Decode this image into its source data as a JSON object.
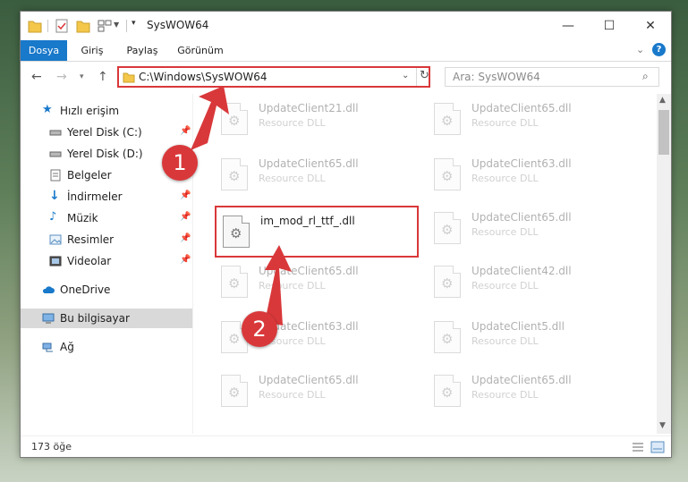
{
  "window": {
    "title": "SysWOW64",
    "controls": {
      "minimize": "—",
      "maximize": "☐",
      "close": "✕"
    }
  },
  "ribbon": {
    "tabs": [
      "Dosya",
      "Giriş",
      "Paylaş",
      "Görünüm"
    ],
    "active_tab": "Dosya"
  },
  "address": {
    "path": "C:\\Windows\\SysWOW64",
    "search_placeholder": "Ara: SysWOW64"
  },
  "nav": {
    "items": [
      {
        "label": "Hızlı erişim",
        "icon": "star-icon",
        "pinned": false
      },
      {
        "label": "Yerel Disk (C:)",
        "icon": "drive-icon",
        "pinned": true
      },
      {
        "label": "Yerel Disk (D:)",
        "icon": "drive-icon",
        "pinned": false
      },
      {
        "label": "Belgeler",
        "icon": "documents-icon",
        "pinned": false
      },
      {
        "label": "İndirmeler",
        "icon": "download-icon",
        "pinned": true
      },
      {
        "label": "Müzik",
        "icon": "music-icon",
        "pinned": true
      },
      {
        "label": "Resimler",
        "icon": "pictures-icon",
        "pinned": true
      },
      {
        "label": "Videolar",
        "icon": "videos-icon",
        "pinned": true
      },
      {
        "label": "OneDrive",
        "icon": "cloud-icon",
        "pinned": false
      },
      {
        "label": "Bu bilgisayar",
        "icon": "computer-icon",
        "pinned": false,
        "selected": true
      },
      {
        "label": "Ağ",
        "icon": "network-icon",
        "pinned": false
      }
    ]
  },
  "files": [
    {
      "name": "UpdateClient21.dll",
      "type": "Resource DLL"
    },
    {
      "name": "UpdateClient65.dll",
      "type": "Resource DLL"
    },
    {
      "name": "UpdateClient65.dll",
      "type": "Resource DLL"
    },
    {
      "name": "UpdateClient63.dll",
      "type": "Resource DLL"
    },
    {
      "name": "im_mod_rl_ttf_.dll",
      "type": ""
    },
    {
      "name": "UpdateClient65.dll",
      "type": "Resource DLL"
    },
    {
      "name": "UpdateClient65.dll",
      "type": "Resource DLL"
    },
    {
      "name": "UpdateClient42.dll",
      "type": "Resource DLL"
    },
    {
      "name": "UpdateClient63.dll",
      "type": "Resource DLL"
    },
    {
      "name": "UpdateClient5.dll",
      "type": "Resource DLL"
    },
    {
      "name": "UpdateClient65.dll",
      "type": "Resource DLL"
    },
    {
      "name": "UpdateClient65.dll",
      "type": "Resource DLL"
    }
  ],
  "status": {
    "count": "173 öğe"
  },
  "annotations": {
    "step1": "1",
    "step2": "2",
    "color": "#d9383a"
  }
}
